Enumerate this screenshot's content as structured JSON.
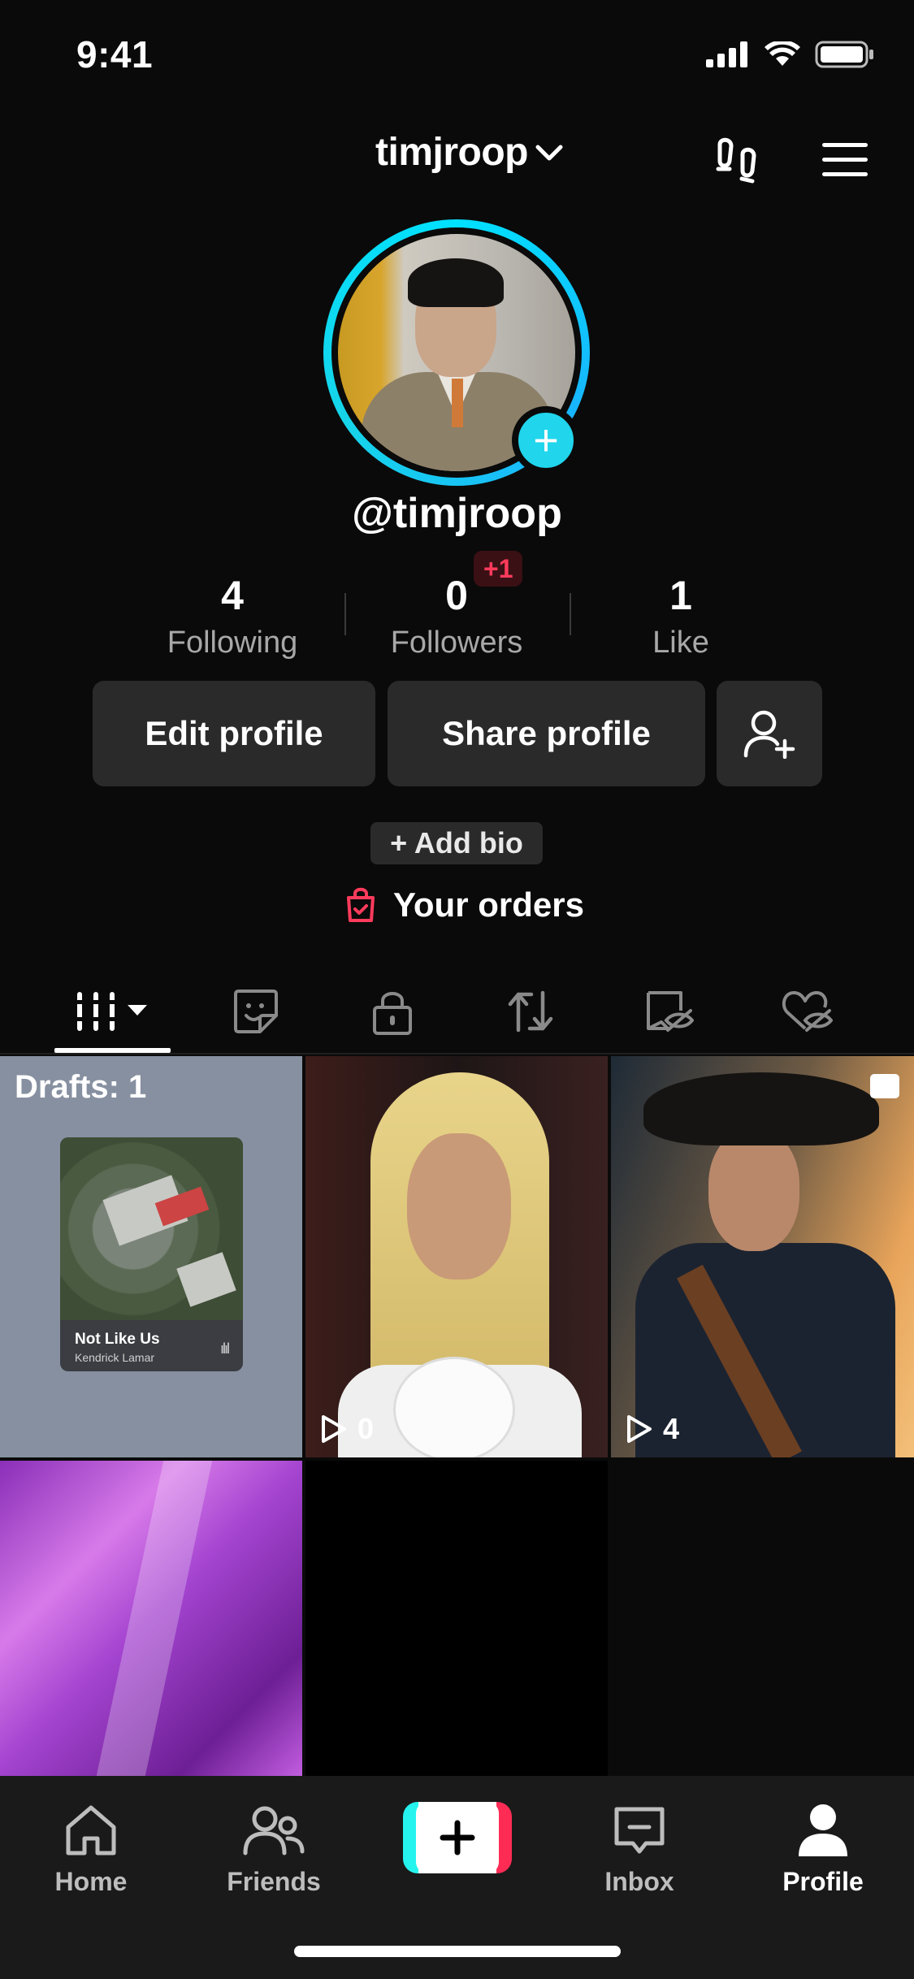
{
  "status_bar": {
    "time": "9:41"
  },
  "header": {
    "username": "timjroop"
  },
  "profile": {
    "handle": "@timjroop",
    "stats": [
      {
        "value": "4",
        "label": "Following"
      },
      {
        "value": "0",
        "label": "Followers",
        "badge": "+1"
      },
      {
        "value": "1",
        "label": "Like"
      }
    ],
    "buttons": {
      "edit": "Edit profile",
      "share": "Share profile"
    },
    "add_bio": "+ Add bio",
    "orders": "Your orders"
  },
  "tabs": [
    {
      "icon": "videos-grid-icon",
      "active": true
    },
    {
      "icon": "sticker-icon"
    },
    {
      "icon": "lock-icon"
    },
    {
      "icon": "repost-icon"
    },
    {
      "icon": "favorites-hidden-icon"
    },
    {
      "icon": "liked-hidden-icon"
    }
  ],
  "grid": {
    "drafts": {
      "label": "Drafts: 1",
      "song": "Not Like Us",
      "artist": "Kendrick Lamar"
    },
    "videos": [
      {
        "views": "0"
      },
      {
        "views": "4"
      }
    ]
  },
  "nav": {
    "items": [
      {
        "label": "Home",
        "icon": "home-icon"
      },
      {
        "label": "Friends",
        "icon": "friends-icon"
      },
      {
        "label": "",
        "icon": "create-icon"
      },
      {
        "label": "Inbox",
        "icon": "inbox-icon"
      },
      {
        "label": "Profile",
        "icon": "profile-icon",
        "active": true
      }
    ]
  },
  "colors": {
    "accent_cyan": "#20d5ec",
    "badge_red": "#ff3b5c",
    "background": "#0a0a0a",
    "button_bg": "#2a2a2a"
  }
}
